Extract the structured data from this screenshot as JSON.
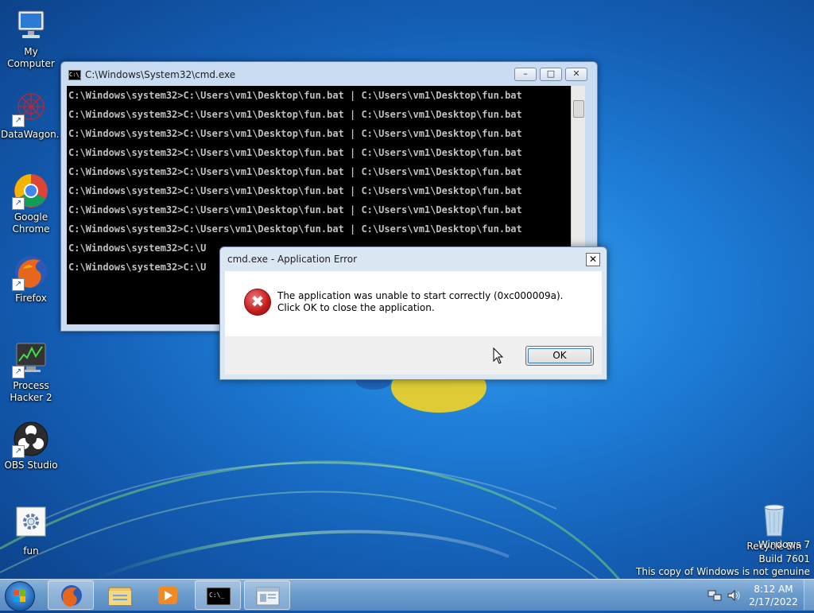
{
  "desktop_icons": [
    {
      "label": "My Computer",
      "icon": "computer-icon"
    },
    {
      "label": "DataWagon...",
      "icon": "datawagon-icon"
    },
    {
      "label": "Google Chrome",
      "icon": "chrome-icon"
    },
    {
      "label": "Firefox",
      "icon": "firefox-icon"
    },
    {
      "label": "Process Hacker 2",
      "icon": "process-hacker-icon"
    },
    {
      "label": "OBS Studio",
      "icon": "obs-icon"
    },
    {
      "label": "fun",
      "icon": "batch-file-icon"
    },
    {
      "label": "Recycle Bin",
      "icon": "recycle-bin-icon"
    }
  ],
  "console_window": {
    "title": "C:\\Windows\\System32\\cmd.exe",
    "lines": [
      "C:\\Windows\\system32>C:\\Users\\vm1\\Desktop\\fun.bat | C:\\Users\\vm1\\Desktop\\fun.bat",
      "C:\\Windows\\system32>C:\\Users\\vm1\\Desktop\\fun.bat | C:\\Users\\vm1\\Desktop\\fun.bat",
      "C:\\Windows\\system32>C:\\Users\\vm1\\Desktop\\fun.bat | C:\\Users\\vm1\\Desktop\\fun.bat",
      "C:\\Windows\\system32>C:\\Users\\vm1\\Desktop\\fun.bat | C:\\Users\\vm1\\Desktop\\fun.bat",
      "C:\\Windows\\system32>C:\\Users\\vm1\\Desktop\\fun.bat | C:\\Users\\vm1\\Desktop\\fun.bat",
      "C:\\Windows\\system32>C:\\Users\\vm1\\Desktop\\fun.bat | C:\\Users\\vm1\\Desktop\\fun.bat",
      "C:\\Windows\\system32>C:\\Users\\vm1\\Desktop\\fun.bat | C:\\Users\\vm1\\Desktop\\fun.bat",
      "C:\\Windows\\system32>C:\\Users\\vm1\\Desktop\\fun.bat | C:\\Users\\vm1\\Desktop\\fun.bat",
      "C:\\Windows\\system32>C:\\U",
      "C:\\Windows\\system32>C:\\U"
    ],
    "minimize_glyph": "–",
    "maximize_glyph": "□",
    "close_glyph": "✕"
  },
  "error_dialog": {
    "title": "cmd.exe - Application Error",
    "message": "The application was unable to start correctly (0xc000009a). Click OK to close the application.",
    "ok_label": "OK",
    "close_glyph": "✕",
    "error_glyph": "✖"
  },
  "watermark": {
    "line1": "Windows 7",
    "line2": "Build 7601",
    "line3": "This copy of Windows is not genuine"
  },
  "taskbar": {
    "pinned": [
      "firefox-icon",
      "explorer-icon",
      "media-player-icon",
      "cmd-icon",
      "window-icon"
    ],
    "time": "8:12 AM",
    "date": "2/17/2022"
  }
}
